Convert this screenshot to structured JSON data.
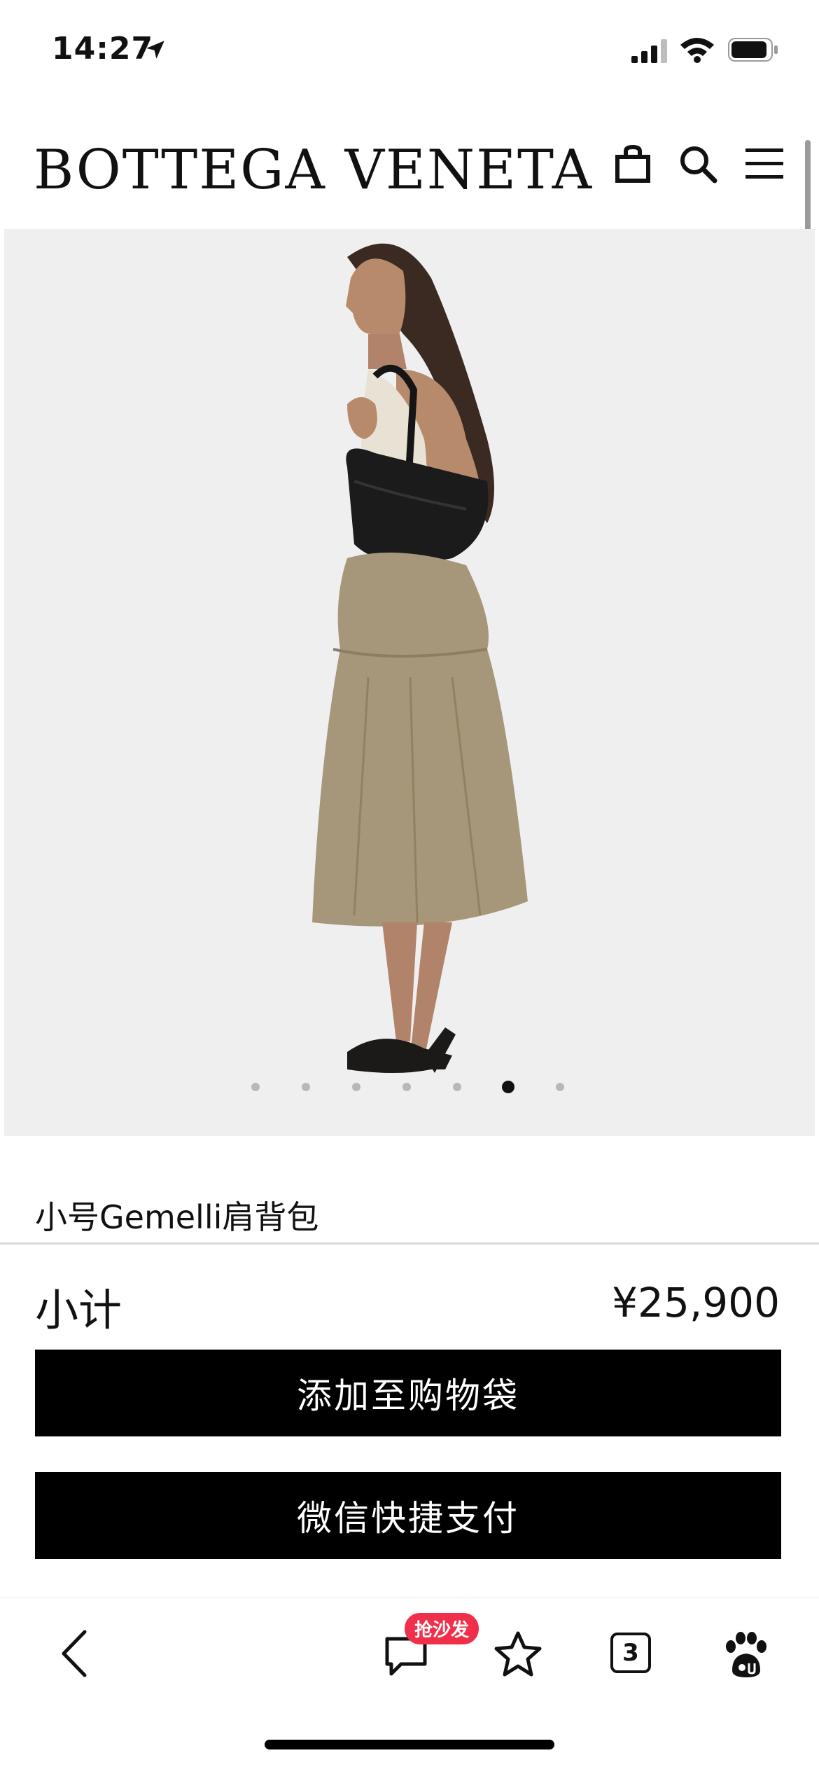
{
  "status": {
    "time": "14:27"
  },
  "header": {
    "brand": "BOTTEGA VENETA"
  },
  "gallery": {
    "dot_count": 7,
    "active_index": 5
  },
  "product": {
    "name": "小号Gemelli肩背包"
  },
  "checkout": {
    "subtotal_label": "小计",
    "subtotal_price": "¥25,900",
    "add_to_bag": "添加至购物袋",
    "wechat_pay": "微信快捷支付"
  },
  "browser_toolbar": {
    "comment_badge": "抢沙发",
    "tab_count": "3"
  },
  "colors": {
    "image_bg": "#efefef",
    "button_bg": "#000000",
    "badge_bg": "#f0304a"
  }
}
